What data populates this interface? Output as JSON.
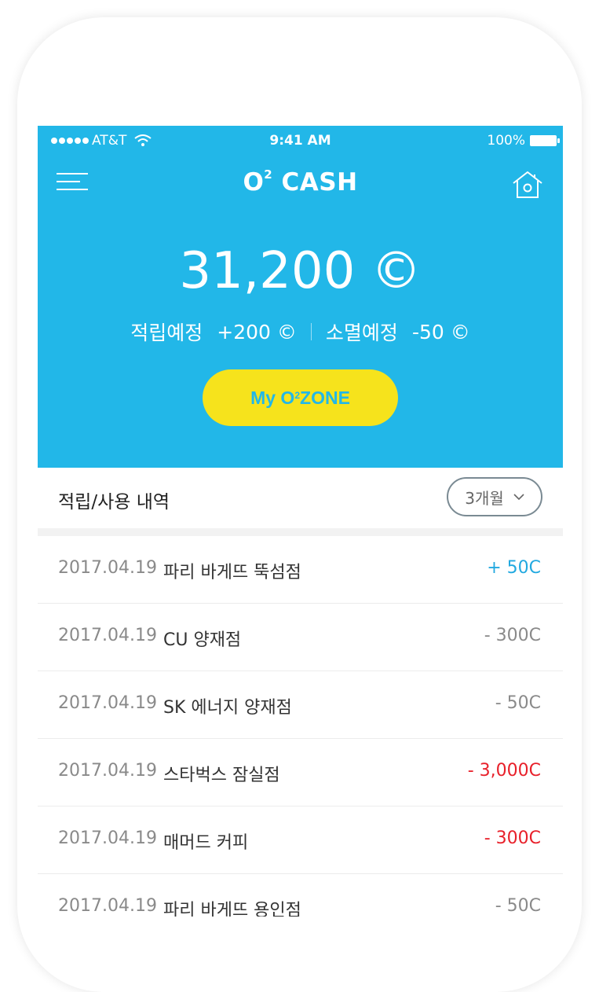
{
  "status_bar": {
    "carrier": "AT&T",
    "time": "9:41 AM",
    "battery": "100%"
  },
  "nav": {
    "title": "O",
    "title_sup": "2",
    "title_rest": " CASH"
  },
  "balance": "31,200 ©",
  "summary": {
    "earn_label": "적립예정",
    "earn_value": "+200 ©",
    "expire_label": "소멸예정",
    "expire_value": "-50 ©"
  },
  "zone_button": {
    "pre": "My O",
    "sup": "2",
    "post": " ZONE"
  },
  "history": {
    "title": "적립/사용 내역",
    "period": "3개월",
    "rows": [
      {
        "date": "2017.04.19",
        "store": "파리 바게뜨 뚝섬점",
        "amount": "+ 50C",
        "color": "#22a9e0"
      },
      {
        "date": "2017.04.19",
        "store": "CU 양재점",
        "amount": "- 300C",
        "color": "#8a8a8a"
      },
      {
        "date": "2017.04.19",
        "store": "SK 에너지 양재점",
        "amount": "- 50C",
        "color": "#8a8a8a"
      },
      {
        "date": "2017.04.19",
        "store": "스타벅스 잠실점",
        "amount": "- 3,000C",
        "color": "#e8202a"
      },
      {
        "date": "2017.04.19",
        "store": "매머드 커피",
        "amount": "- 300C",
        "color": "#e8202a"
      },
      {
        "date": "2017.04.19",
        "store": "파리 바게뜨 용인점",
        "amount": "- 50C",
        "color": "#8a8a8a"
      }
    ]
  },
  "colors": {
    "primary": "#22b7e8",
    "accent_button": "#f6e31c",
    "negative": "#e8202a"
  },
  "icons": [
    "menu-icon",
    "home-icon",
    "wifi-icon",
    "battery-icon",
    "chevron-down-icon"
  ]
}
